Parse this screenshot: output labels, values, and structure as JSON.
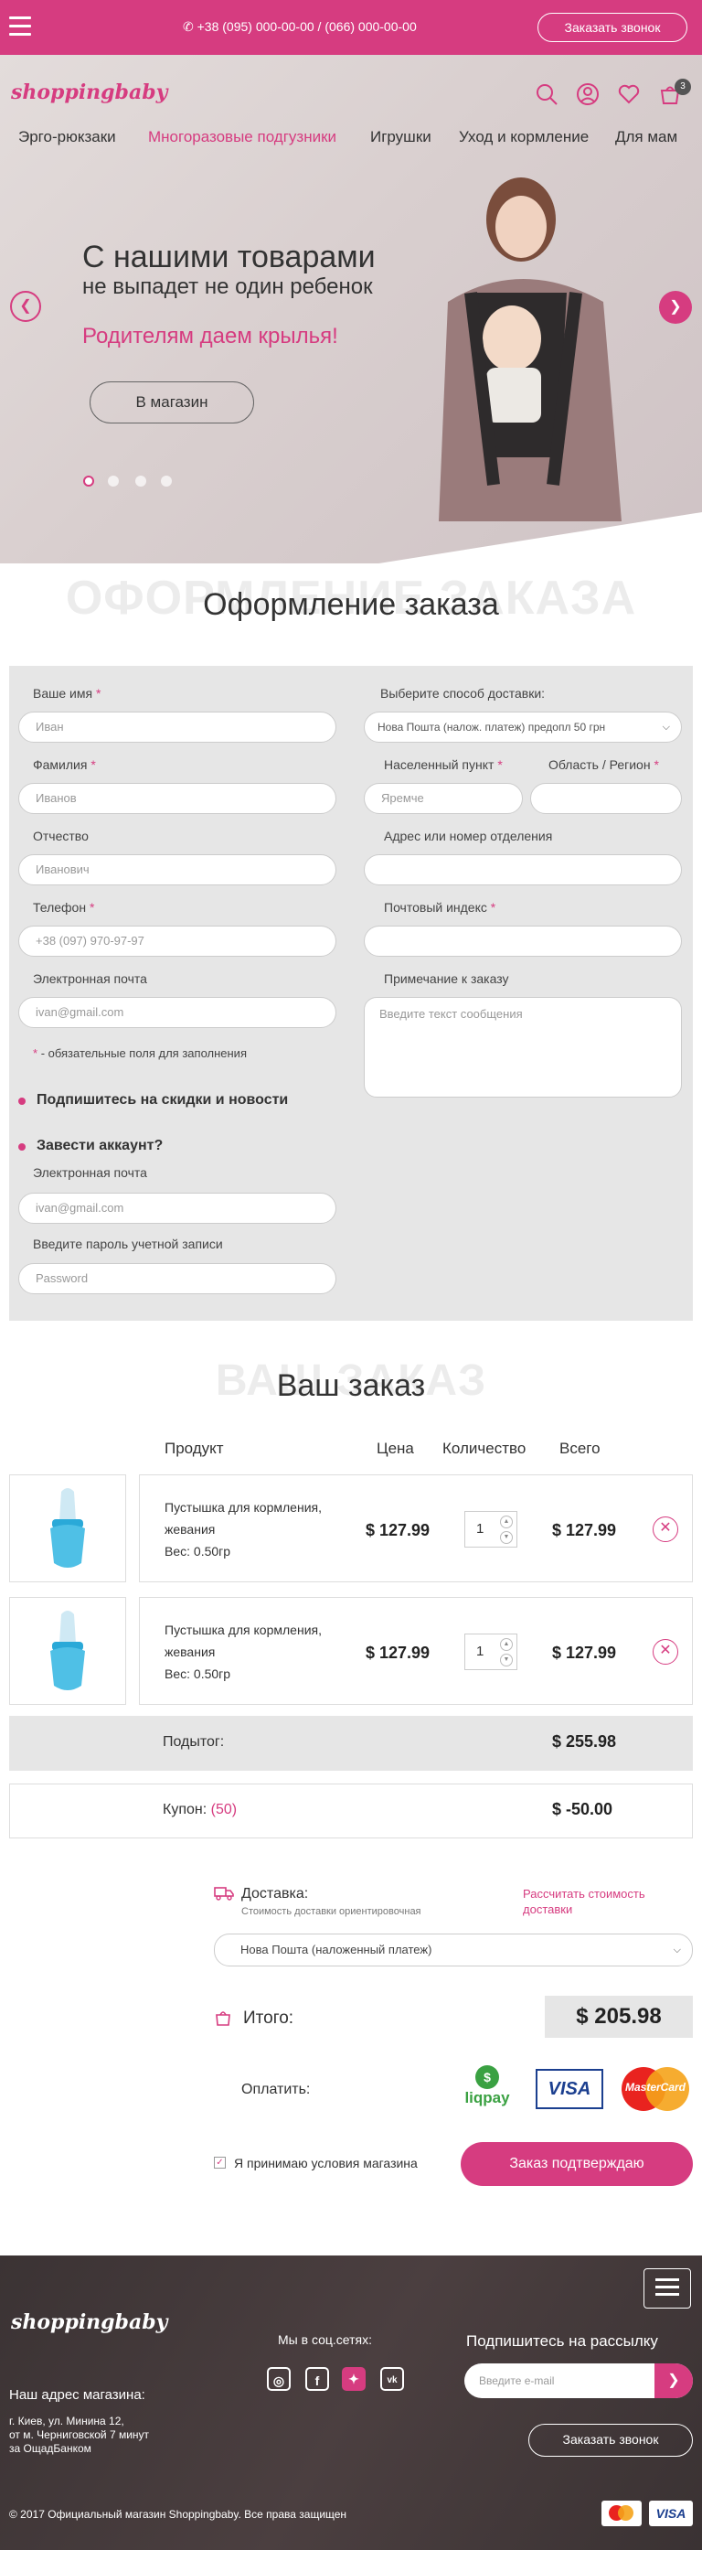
{
  "header": {
    "phones": "+38 (095) 000-00-00 / (066) 000-00-00",
    "call_button": "Заказать звонок",
    "logo": "shoppingbaby",
    "cart_count": "3",
    "nav": [
      "Эрго-рюкзаки",
      "Многоразовые подгузники",
      "Игрушки",
      "Уход и кормление",
      "Для мам"
    ]
  },
  "hero": {
    "title": "С нашими товарами",
    "subtitle": "не выпадет не один ребенок",
    "tagline": "Родителям даем крылья!",
    "button": "В магазин"
  },
  "checkout": {
    "watermark": "ОФОРМЛЕНИЕ ЗАКАЗА",
    "title": "Оформление заказа",
    "name_label": "Ваше имя",
    "name_value": "Иван",
    "surname_label": "Фамилия",
    "surname_value": "Иванов",
    "patronymic_label": "Отчество",
    "patronymic_value": "Иванович",
    "phone_label": "Телефон",
    "phone_value": "+38 (097) 970-97-97",
    "email_label": "Электронная почта",
    "email_value": "ivan@gmail.com",
    "required_note": "- обязательные поля для заполнения",
    "subscribe_label": "Подпишитесь на скидки и новости",
    "create_account_label": "Завести аккаунт?",
    "acc_email_label": "Электронная почта",
    "acc_email_value": "ivan@gmail.com",
    "acc_password_label": "Введите пароль учетной записи",
    "acc_password_placeholder": "Password",
    "delivery_label": "Выберите способ доставки:",
    "delivery_value": "Нова Пошта (налож. платеж)  предопл 50 грн",
    "city_label": "Населенный пункт",
    "city_value": "Яремче",
    "region_label": "Область / Регион",
    "address_label": "Адрес или номер отделения",
    "zip_label": "Почтовый индекс",
    "note_label": "Примечание к заказу",
    "note_placeholder": "Введите текст сообщения"
  },
  "order": {
    "watermark": "ВАШ ЗАКАЗ",
    "title": "Ваш заказ",
    "headers": {
      "product": "Продукт",
      "price": "Цена",
      "qty": "Количество",
      "total": "Всего"
    },
    "items": [
      {
        "name1": "Пустышка для кормления,",
        "name2": "жевания",
        "weight": "Вес: 0.50гр",
        "price": "$ 127.99",
        "qty": "1",
        "total": "$ 127.99"
      },
      {
        "name1": "Пустышка для кормления,",
        "name2": "жевания",
        "weight": "Вес: 0.50гр",
        "price": "$ 127.99",
        "qty": "1",
        "total": "$ 127.99"
      }
    ],
    "subtotal_label": "Подытог:",
    "subtotal_value": "$ 255.98",
    "coupon_label": "Купон:",
    "coupon_code": "(50)",
    "coupon_value": "$ -50.00",
    "shipping_label": "Доставка:",
    "shipping_note": "Стоимость доставки ориентировочная",
    "calc_link": "Рассчитать стоимость доставки",
    "shipping_select": "Нова Пошта (наложенный платеж)",
    "total_label": "Итого:",
    "total_value": "$ 205.98",
    "pay_label": "Оплатить:",
    "pay_methods": [
      "liqpay",
      "VISA",
      "MasterCard"
    ],
    "terms_label": "Я принимаю условия магазина",
    "confirm_button": "Заказ подтверждаю"
  },
  "footer": {
    "logo": "shoppingbaby",
    "social_label": "Мы в соц.сетях:",
    "social_icons": [
      "instagram-icon",
      "facebook-icon",
      "twitter-icon",
      "vk-icon"
    ],
    "newsletter_title": "Подпишитесь на рассылку",
    "email_placeholder": "Введите e-mail",
    "address_title": "Наш адрес магазина:",
    "address_lines": [
      "г. Киев, ул. Минина 12,",
      "от м. Черниговской 7 минут",
      "за ОщадБанком"
    ],
    "call_button": "Заказать звонок",
    "copyright": "© 2017 Официальный магазин Shoppingbaby. Все права защищен",
    "cards": [
      "MasterCard",
      "VISA"
    ]
  },
  "colors": {
    "accent": "#d63c80",
    "dark": "#3b3334",
    "form_bg": "#e6e6e6"
  }
}
